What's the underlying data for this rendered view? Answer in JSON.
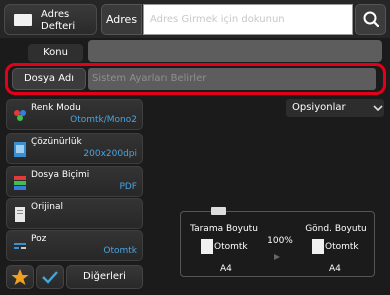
{
  "topbar": {
    "address_book_label_line1": "Adres",
    "address_book_label_line2": "Defteri",
    "address_tab_label": "Adres",
    "address_placeholder": "Adres Girmek için dokunun"
  },
  "subject": {
    "label": "Konu",
    "value": ""
  },
  "file_name": {
    "label": "Dosya Adı",
    "placeholder": "Sistem Ayarları Belirler"
  },
  "settings": [
    {
      "title": "Renk Modu",
      "value": "Otomtk/Mono2",
      "icon": "color-mode-icon"
    },
    {
      "title": "Çözünürlük",
      "value": "200x200dpi",
      "icon": "resolution-icon"
    },
    {
      "title": "Dosya Biçimi",
      "value": "PDF",
      "icon": "file-format-icon"
    },
    {
      "title": "Orijinal",
      "value": "",
      "icon": "original-icon"
    },
    {
      "title": "Poz",
      "value": "Otomtk",
      "icon": "exposure-icon"
    }
  ],
  "options_label": "Opsiyonlar",
  "preview": {
    "scan_size_label": "Tarama Boyutu",
    "scan_auto": "Otomtk",
    "scan_paper": "A4",
    "ratio": "100%",
    "send_size_label": "Gönd. Boyutu",
    "send_auto": "Otomtk",
    "send_paper": "A4"
  },
  "bottom": {
    "others_label": "Diğerleri"
  },
  "colors": {
    "accent_blue": "#4aa3df",
    "highlight_red": "#e3001b",
    "star_orange": "#f0a020",
    "check_teal": "#3fa9d9"
  }
}
